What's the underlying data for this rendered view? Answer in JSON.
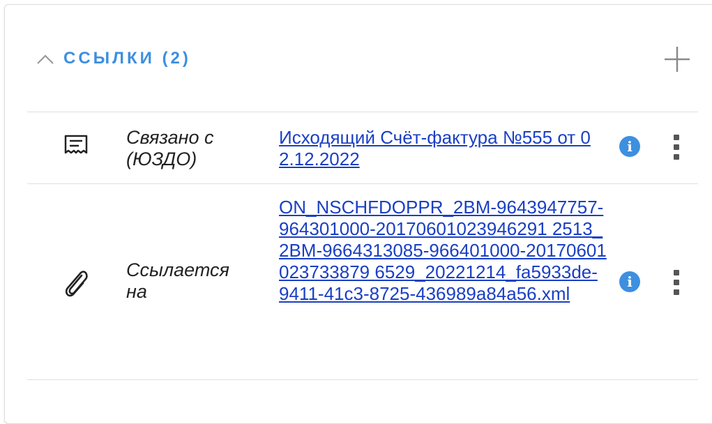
{
  "section": {
    "title": "ССЫЛКИ (2)",
    "collapse_icon": "chevron-up-icon",
    "add_icon": "plus-icon"
  },
  "links": [
    {
      "icon": "document-receipt-icon",
      "relation": "Связано с (ЮЗДО)",
      "link_text": "Исходящий Счёт-фактура №555 от 02.12.2022",
      "info_icon": "info-icon",
      "menu_icon": "more-vertical-icon"
    },
    {
      "icon": "paperclip-icon",
      "relation": "Ссылается на",
      "link_text": "ON_NSCHFDOPPR_2BM-9643947757-964301000-20170601023946291 2513_2BM-9664313085-966401000-20170601023733879 6529_20221214_fa5933de-9411-41c3-8725-436989a84a56.xml",
      "info_icon": "info-icon",
      "menu_icon": "more-vertical-icon"
    }
  ],
  "colors": {
    "accent": "#3d8fe0",
    "link": "#1a3fc4",
    "divider": "#dedede"
  }
}
